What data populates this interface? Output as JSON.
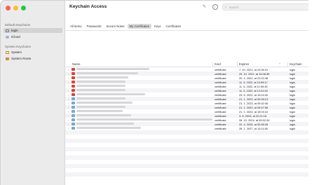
{
  "sidebar": {
    "default_heading": "Default Keychains",
    "system_heading": "System Keychains",
    "default_items": [
      {
        "label": "login",
        "icon": "lock-icon",
        "selected": true
      },
      {
        "label": "iCloud",
        "icon": "cloud-icon",
        "selected": false
      }
    ],
    "system_items": [
      {
        "label": "System",
        "icon": "lock-icon"
      },
      {
        "label": "System Roots",
        "icon": "cabinet-icon"
      }
    ]
  },
  "window": {
    "title": "Keychain Access"
  },
  "search": {
    "placeholder": "Search"
  },
  "tabs": [
    {
      "label": "All Items",
      "active": false
    },
    {
      "label": "Passwords",
      "active": false
    },
    {
      "label": "Secure Notes",
      "active": false
    },
    {
      "label": "My Certificates",
      "active": true
    },
    {
      "label": "Keys",
      "active": false
    },
    {
      "label": "Certificates",
      "active": false
    }
  ],
  "table": {
    "headers": {
      "name": "Name",
      "kind": "Kind",
      "expires": "Expires",
      "keychain": "Keychain",
      "sort_indicator": "^"
    },
    "rows": [
      {
        "kind": "certificate",
        "expires": "7. 10. 2021, at 22:06:31",
        "keychain": "login",
        "icon": "red"
      },
      {
        "kind": "certificate",
        "expires": "29. 10. 2021, at 19:08:39",
        "keychain": "login",
        "icon": "red"
      },
      {
        "kind": "certificate",
        "expires": "20. 4. 2022, at 22:22:48",
        "keychain": "login",
        "icon": "red"
      },
      {
        "kind": "certificate",
        "expires": "11. 5. 2022, at 10:59:17",
        "keychain": "login",
        "icon": "red"
      },
      {
        "kind": "certificate",
        "expires": "11. 5. 2022, at 11:59:35",
        "keychain": "login",
        "icon": "red"
      },
      {
        "kind": "certificate",
        "expires": "11. 5. 2022, at 12:01:00",
        "keychain": "login",
        "icon": "red"
      },
      {
        "kind": "certificate",
        "expires": "23. 6. 2022, at 19:24:40",
        "keychain": "login",
        "icon": "red"
      },
      {
        "kind": "certificate",
        "expires": "21. 1. 2023, at 09:28:13",
        "keychain": "login",
        "icon": "blue"
      },
      {
        "kind": "certificate",
        "expires": "21. 1. 2023, at 09:32:46",
        "keychain": "login",
        "icon": "blue"
      },
      {
        "kind": "certificate",
        "expires": "21. 1. 2023, at 09:47:56",
        "keychain": "login",
        "icon": "blue"
      },
      {
        "kind": "certificate",
        "expires": "21. 1. 2023, at 15:04:10",
        "keychain": "login",
        "icon": "blue"
      },
      {
        "kind": "certificate",
        "expires": "3. 8. 2023, at 22:21:18",
        "keychain": "login",
        "icon": "blue"
      },
      {
        "kind": "certificate",
        "expires": "28. 10. 2024, at 09:52:34",
        "keychain": "login",
        "icon": "blue"
      },
      {
        "kind": "certificate",
        "expires": "22. 4. 2025, at 00:48:28",
        "keychain": "login",
        "icon": "blue"
      },
      {
        "kind": "certificate",
        "expires": "28. 1. 2027, at 13:11:55",
        "keychain": "login",
        "icon": "blue"
      }
    ],
    "empty_rows": 11
  },
  "colors": {
    "close": "#ff5f57",
    "minimize": "#febc2e",
    "zoom": "#28c840",
    "sidebar_bg": "#ebebeb",
    "selected_row": "#d3d3d3"
  }
}
